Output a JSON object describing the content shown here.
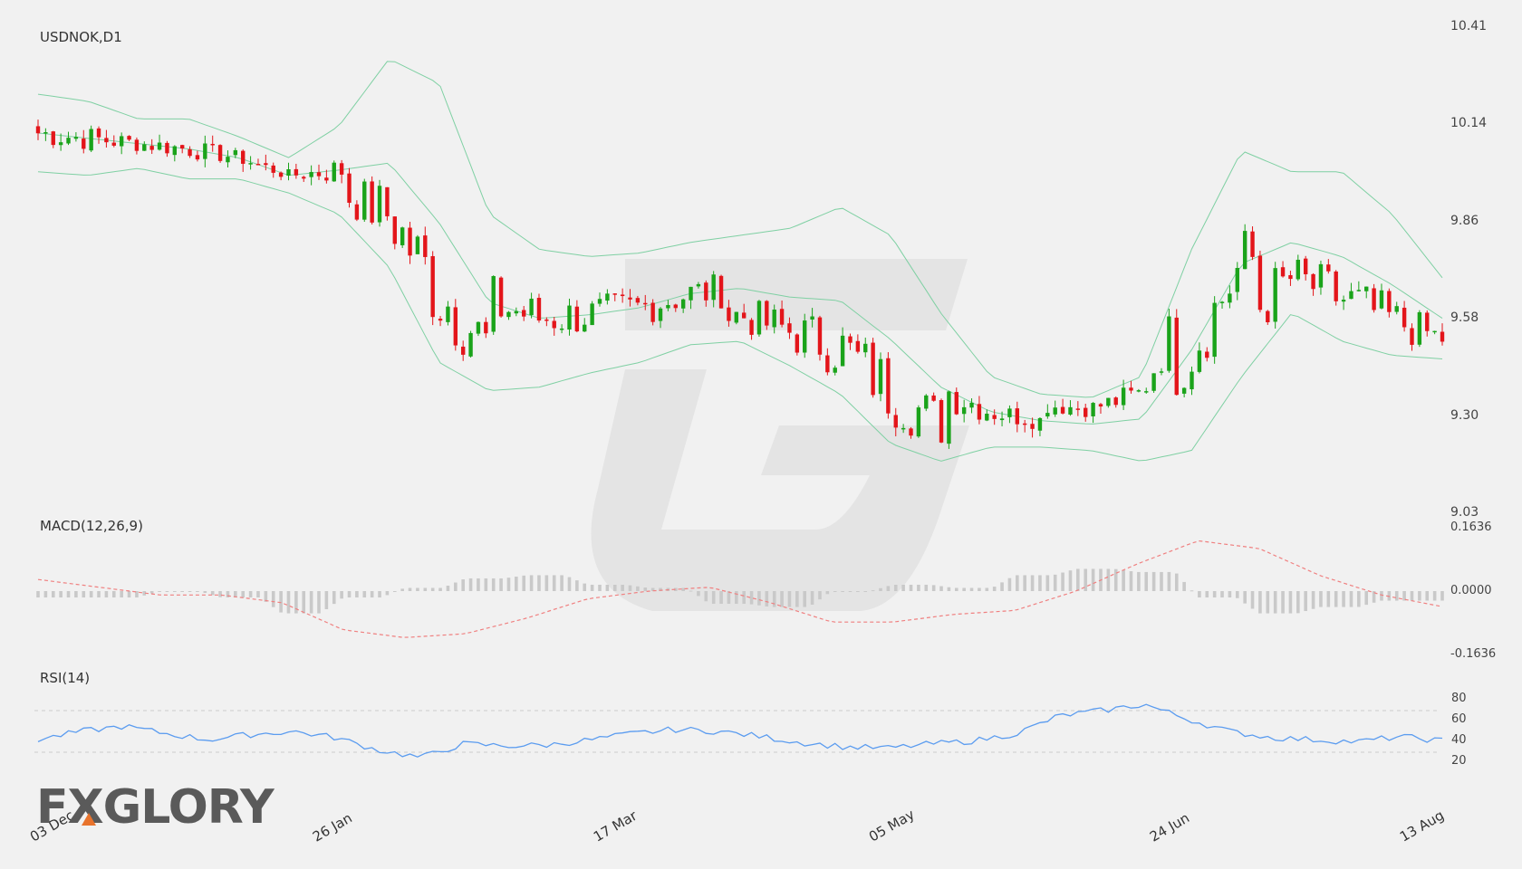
{
  "header": {
    "symbol_title": "USDNOK,D1"
  },
  "panes": {
    "macd_label": "MACD(12,26,9)",
    "rsi_label": "RSI(14)"
  },
  "logo": {
    "text": "FXGLORY",
    "accent_color": "#e8732c"
  },
  "colors": {
    "bull": "#1aa31a",
    "bear": "#e3151a",
    "band": "#7fd0a3",
    "macd_signal": "#f08080",
    "macd_hist": "#c9c9c9",
    "rsi": "#5b9cf0",
    "background": "#f1f1f1"
  },
  "chart_data": [
    {
      "type": "candlestick",
      "title": "USDNOK,D1",
      "ylim": [
        9.03,
        10.41
      ],
      "y_ticks": [
        "10.41",
        "10.14",
        "9.86",
        "9.58",
        "9.30",
        "9.03"
      ],
      "x_tick_labels": [
        "03 Dec",
        "26 Jan",
        "17 Mar",
        "05 May",
        "24 Jun",
        "13 Aug"
      ],
      "overlay": "Bollinger Bands",
      "bollinger_upper_keypoints": [
        10.22,
        10.2,
        10.15,
        10.15,
        10.1,
        10.04,
        10.13,
        10.32,
        10.25,
        9.88,
        9.78,
        9.76,
        9.77,
        9.8,
        9.82,
        9.84,
        9.9,
        9.82,
        9.6,
        9.42,
        9.37,
        9.36,
        9.42,
        9.78,
        10.06,
        10.0,
        10.0,
        9.88,
        9.7
      ],
      "bollinger_lower_keypoints": [
        10.0,
        9.99,
        10.01,
        9.98,
        9.98,
        9.94,
        9.88,
        9.73,
        9.46,
        9.38,
        9.39,
        9.43,
        9.46,
        9.51,
        9.52,
        9.45,
        9.37,
        9.23,
        9.18,
        9.22,
        9.22,
        9.21,
        9.18,
        9.21,
        9.42,
        9.6,
        9.52,
        9.48,
        9.47
      ]
    },
    {
      "type": "bar",
      "title": "MACD(12,26,9)",
      "ylim": [
        -0.1636,
        0.1636
      ],
      "y_ticks": [
        "0.1636",
        "0.0000",
        "-0.1636"
      ],
      "signal_keypoints": [
        0.03,
        0.01,
        -0.01,
        -0.01,
        -0.03,
        -0.1,
        -0.12,
        -0.11,
        -0.07,
        -0.02,
        0.0,
        0.01,
        -0.03,
        -0.08,
        -0.08,
        -0.06,
        -0.05,
        0.0,
        0.07,
        0.13,
        0.11,
        0.04,
        -0.01,
        -0.04
      ]
    },
    {
      "type": "line",
      "title": "RSI(14)",
      "ylim": [
        20,
        80
      ],
      "y_ticks": [
        "80",
        "60",
        "40",
        "20"
      ],
      "reference_lines": [
        70,
        30
      ],
      "values_keypoints": [
        42,
        50,
        55,
        48,
        42,
        47,
        50,
        44,
        32,
        25,
        38,
        36,
        37,
        42,
        48,
        52,
        50,
        45,
        39,
        35,
        34,
        38,
        41,
        48,
        65,
        70,
        76,
        62,
        50,
        44,
        42,
        40,
        45,
        41
      ]
    }
  ]
}
